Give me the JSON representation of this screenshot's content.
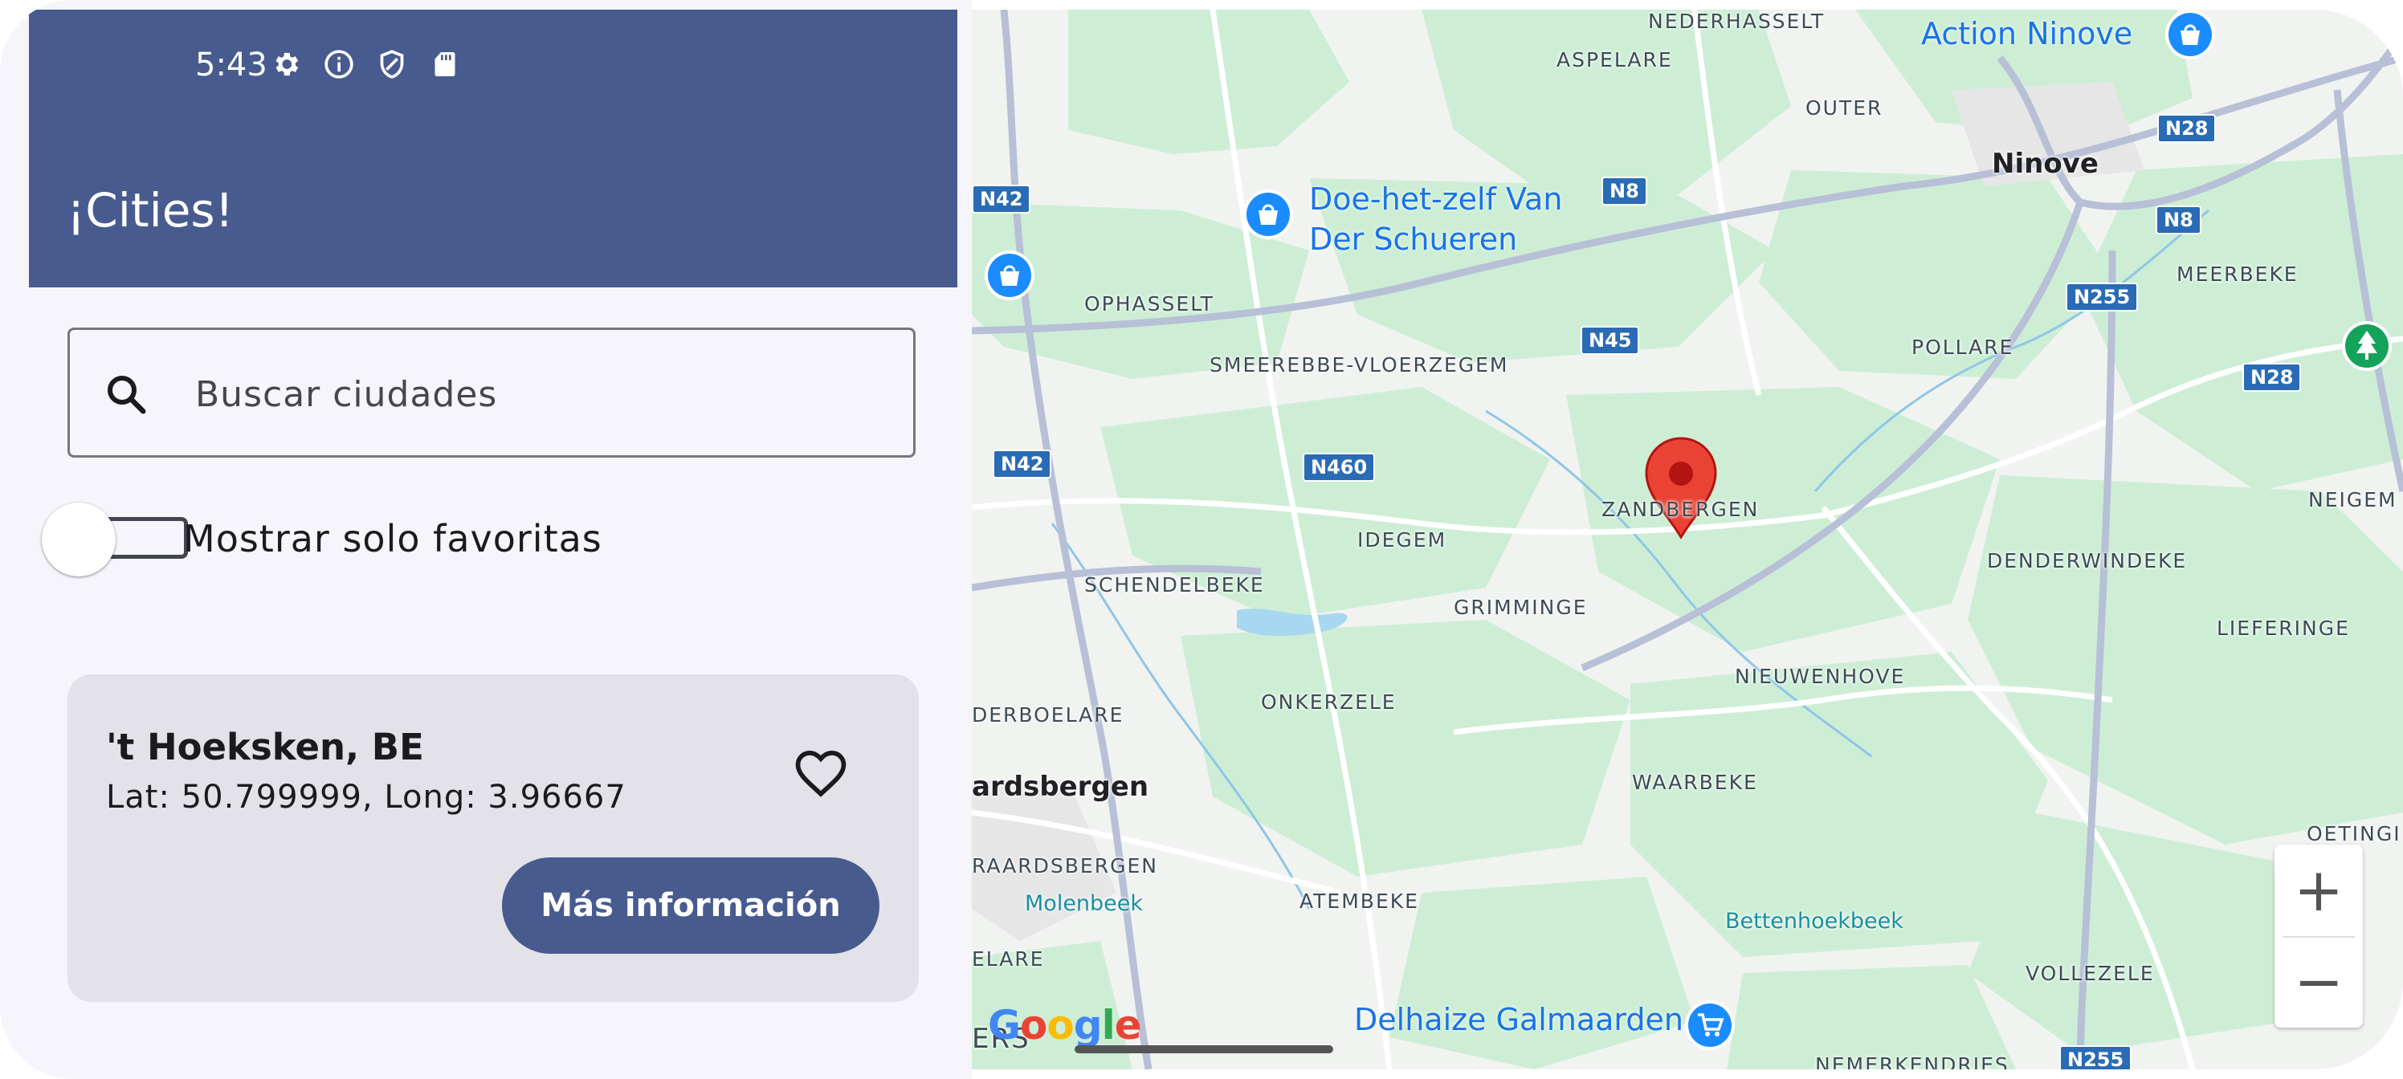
{
  "status_bar": {
    "time": "5:43",
    "icons": [
      "gear-icon",
      "info-icon",
      "shield-icon",
      "sd-card-icon"
    ]
  },
  "app_bar": {
    "title": "¡Cities!"
  },
  "search": {
    "placeholder": "Buscar ciudades",
    "value": ""
  },
  "favorites_filter": {
    "label": "Mostrar solo favoritas",
    "checked": false
  },
  "city_card": {
    "name": "'t Hoeksken, BE",
    "coords": "Lat: 50.799999, Long: 3.96667",
    "favorite": false,
    "button_label": "Más información"
  },
  "map": {
    "places": [
      "NEDERHASSELT",
      "ASPELARE",
      "OUTER",
      "Ninove",
      "MEERBEKE",
      "OPHASSELT",
      "SMEEREBBE-VLOERZEGEM",
      "POLLARE",
      "NEIGEM",
      "ZANDBERGEN",
      "IDEGEM",
      "SCHENDELBEKE",
      "GRIMMINGE",
      "DENDERWINDEKE",
      "LIEFERINGE",
      "NIEUWENHOVE",
      "DERBOELARE",
      "ONKERZELE",
      "ardsbergen",
      "WAARBEKE",
      "RAARDSBERGEN",
      "OETINGI",
      "ATEMBEKE",
      "ELARE",
      "VOLLEZELE",
      "ERS",
      "NEMERKENDRIES"
    ],
    "water_labels": [
      "Molenbeek",
      "Bettenhoekbeek"
    ],
    "pois": [
      "Action Ninove",
      "Doe-het-zelf Van",
      "Der Schueren",
      "Delhaize Galmaarden"
    ],
    "road_shields": [
      "N28",
      "N8",
      "N42",
      "N42",
      "N255",
      "N28",
      "N45",
      "N460",
      "N8",
      "N255"
    ],
    "zoom_in_label": "+",
    "zoom_out_label": "−",
    "attribution": "Google"
  }
}
